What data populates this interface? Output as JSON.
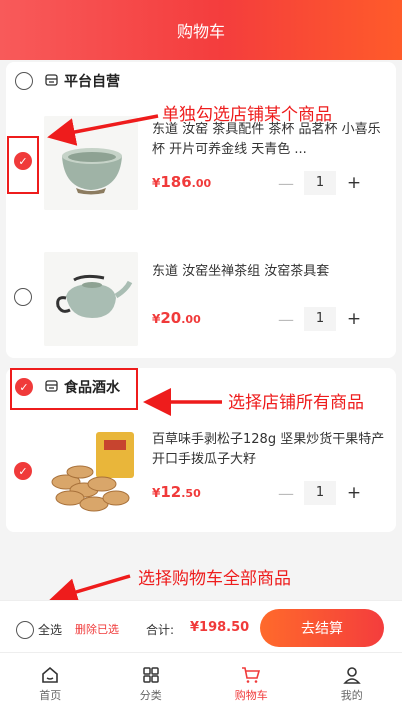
{
  "header": {
    "title": "购物车"
  },
  "shops": [
    {
      "name": "平台自营",
      "items": [
        {
          "name": "东道 汝窑 茶具配件 茶杯 品茗杯 小喜乐杯 开片可养金线 天青色 ...",
          "price_int": "186",
          "price_dec": ".00",
          "qty": "1",
          "checked": true
        },
        {
          "name": "东道 汝窑坐禅茶组 汝窑茶具套",
          "price_int": "20",
          "price_dec": ".00",
          "qty": "1",
          "checked": false
        }
      ]
    },
    {
      "name": "食品酒水",
      "items": [
        {
          "name": "百草味手剥松子128g 坚果炒货干果特产开口手拨瓜子大籽",
          "price_int": "12",
          "price_dec": ".50",
          "qty": "1",
          "checked": true
        }
      ]
    }
  ],
  "currency": "¥",
  "annotations": {
    "item": "单独勾选店铺某个商品",
    "shop": "选择店铺所有商品",
    "all": "选择购物车全部商品"
  },
  "footer": {
    "select_all": "全选",
    "delete": "删除已选",
    "total_label": "合计:",
    "total_value": "¥198.50",
    "checkout": "去结算"
  },
  "tabs": [
    {
      "label": "首页",
      "icon": "home-icon"
    },
    {
      "label": "分类",
      "icon": "category-icon"
    },
    {
      "label": "购物车",
      "icon": "cart-icon"
    },
    {
      "label": "我的",
      "icon": "user-icon"
    }
  ],
  "colors": {
    "accent": "#f03a3a",
    "annotation": "#ee1c1c"
  }
}
